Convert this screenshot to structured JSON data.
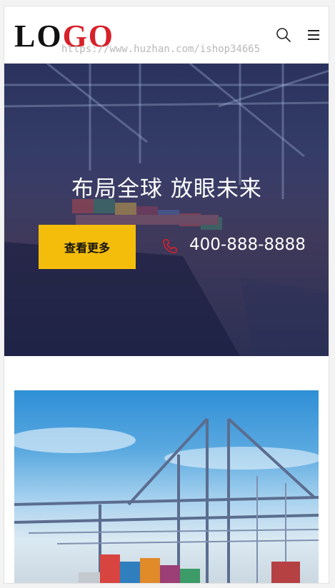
{
  "header": {
    "logo_part1": "LO",
    "logo_part2": "GO",
    "watermark": "https://www.huzhan.com/ishop34665",
    "search_icon": "search-icon",
    "menu_icon": "hamburger-menu-icon"
  },
  "hero": {
    "title": "布局全球 放眼未来",
    "cta_label": "查看更多",
    "phone_icon": "phone-icon",
    "phone_number": "400-888-8888"
  },
  "colors": {
    "accent": "#f4bd0b",
    "logo_red": "#d8202a",
    "hero_overlay": "#1c224e",
    "phone_icon": "#d8202a"
  }
}
